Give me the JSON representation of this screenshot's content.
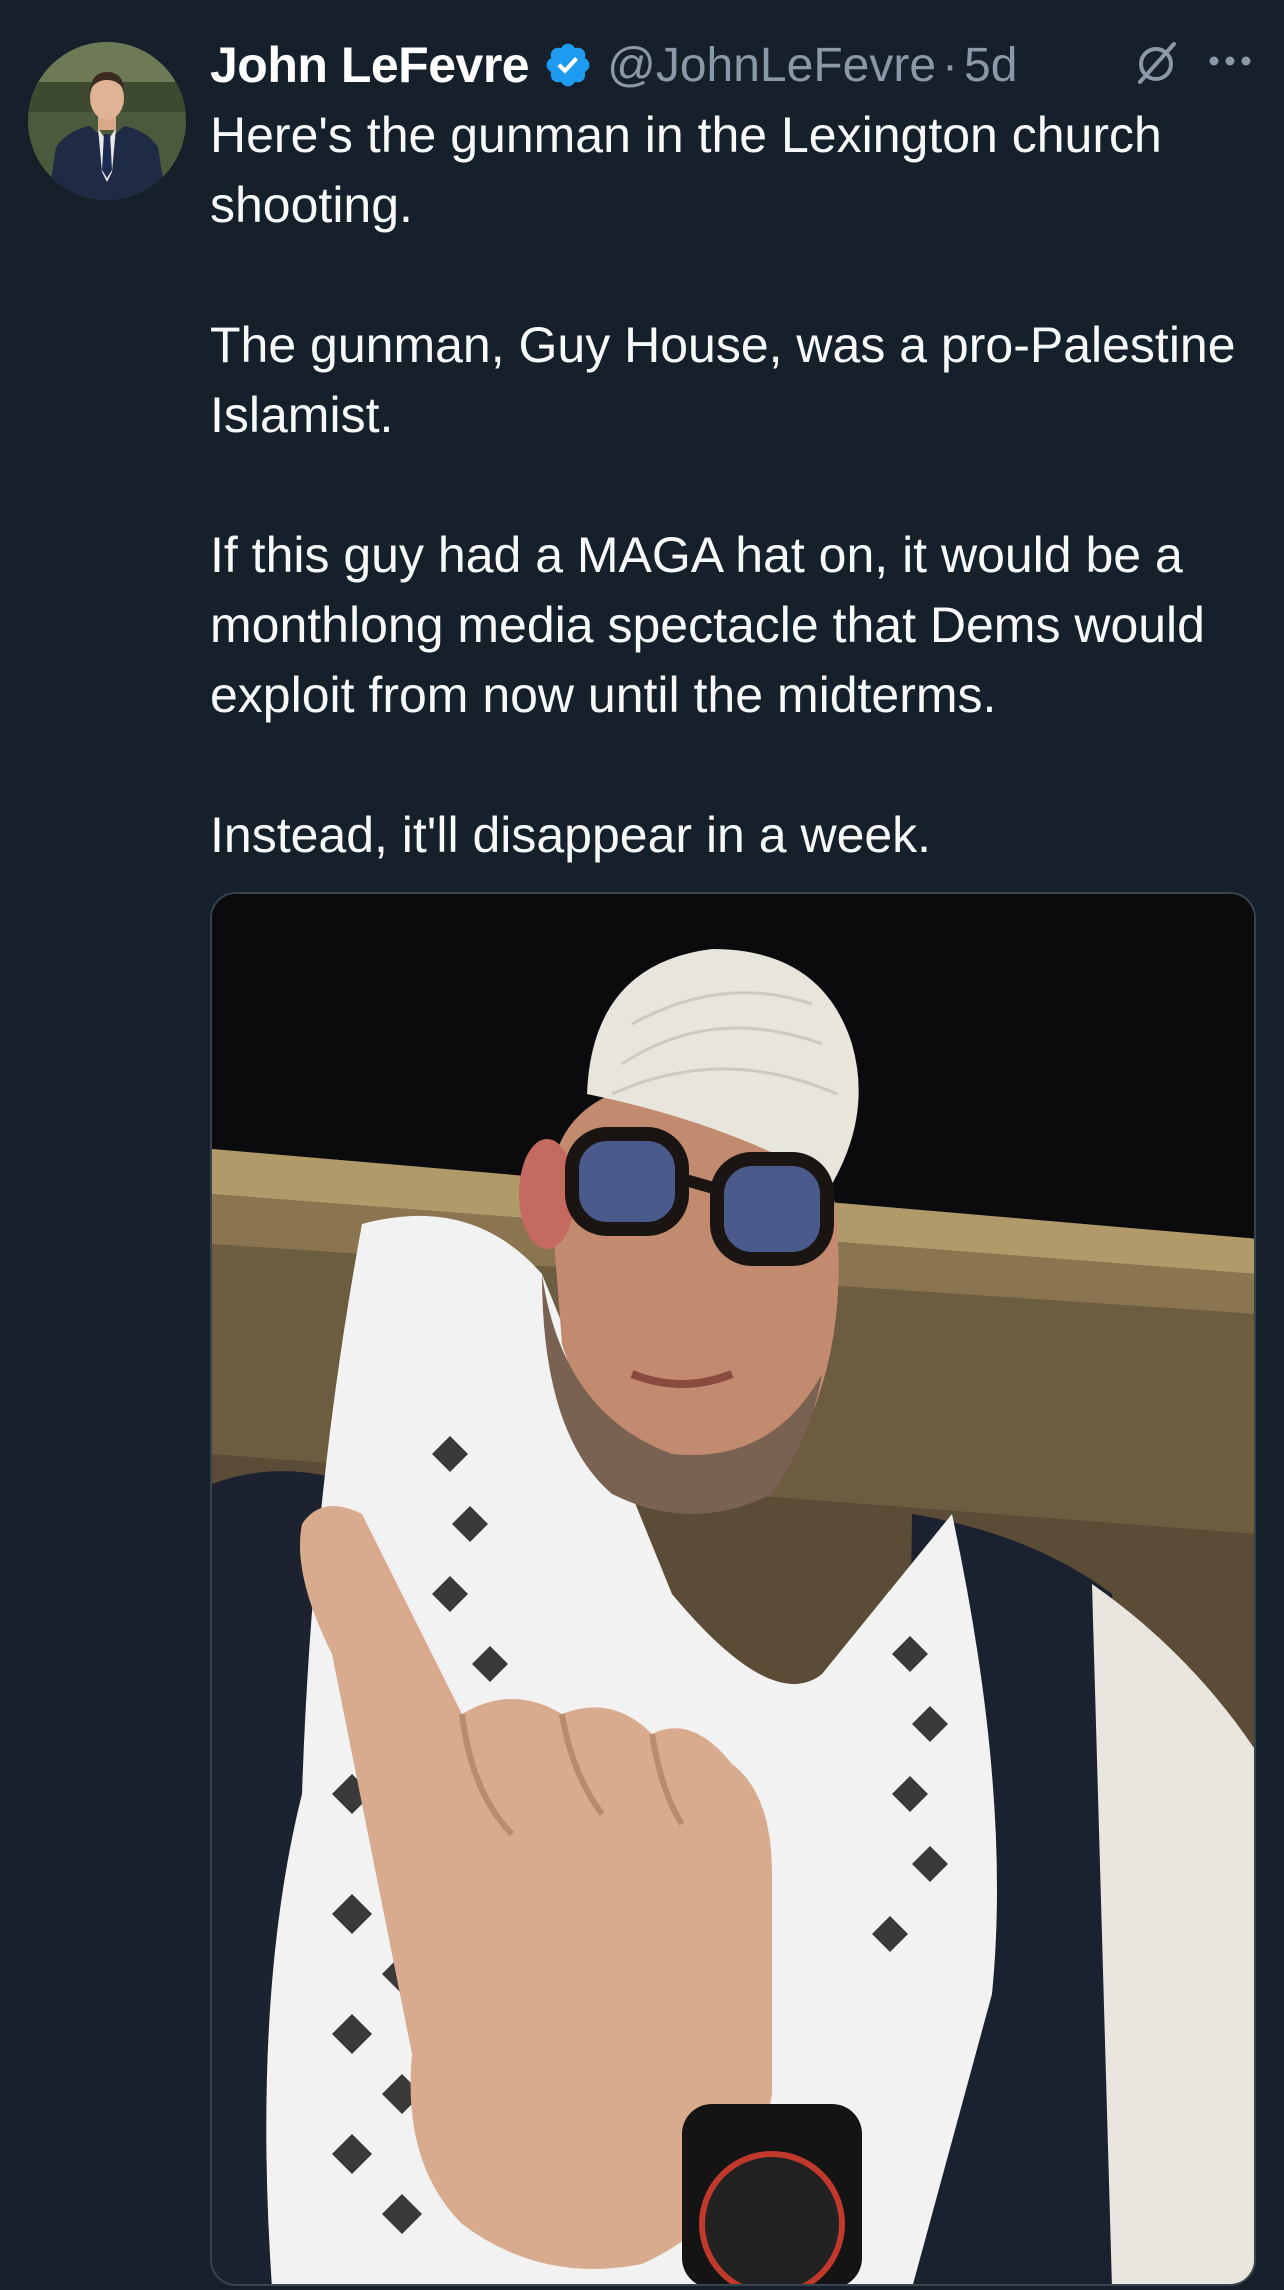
{
  "author": {
    "display_name": "John LeFevre",
    "handle": "@JohnLeFevre",
    "separator": "·",
    "time": "5d",
    "verified": true,
    "verified_color": "#1d9bf0"
  },
  "tweet": {
    "paragraphs": [
      "Here's the gunman in the Lexington church shooting.",
      "The gunman, Guy House, was a pro-Palestine Islamist.",
      "If this guy had a MAGA hat on, it would be a monthlong media spectacle that Dems would exploit from now until the midterms.",
      "Instead, it'll disappear in a week."
    ]
  },
  "icons": {
    "avatar": "avatar",
    "verified": "verified-badge-icon",
    "grok": "grok-icon",
    "more": "more-options-icon"
  },
  "colors": {
    "background": "#15202b",
    "text": "#f7f9f9",
    "secondary_text": "#8b98a5"
  }
}
